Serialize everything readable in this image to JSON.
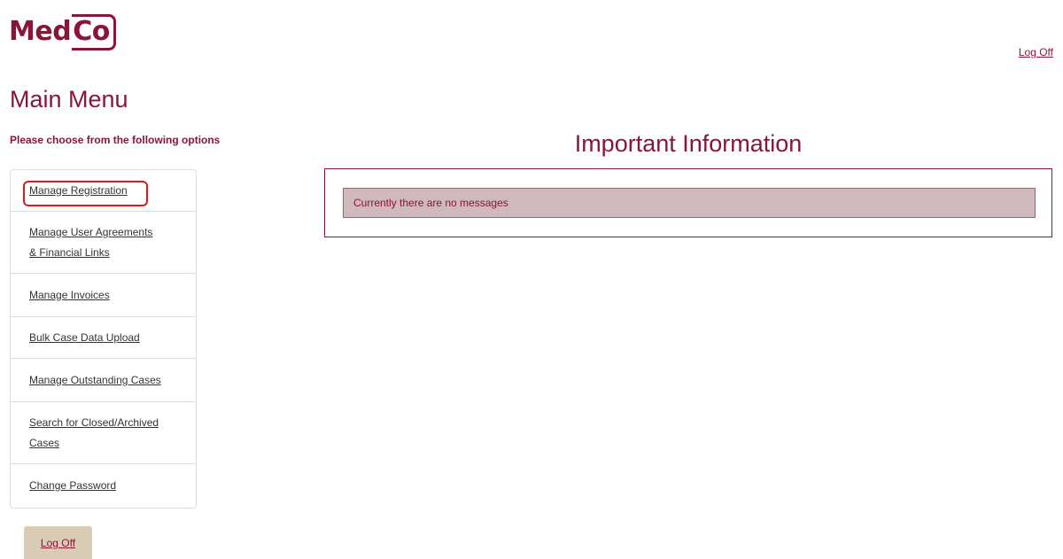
{
  "logo": {
    "part1": "Med",
    "part2": "Co"
  },
  "header": {
    "logoff_label": "Log Off"
  },
  "main": {
    "title": "Main Menu",
    "subtitle": "Please choose from the following options"
  },
  "menu": {
    "items": [
      {
        "line1": "Manage Registration",
        "line2": ""
      },
      {
        "line1": "Manage User Agreements",
        "line2": "& Financial Links"
      },
      {
        "line1": "Manage Invoices",
        "line2": ""
      },
      {
        "line1": "Bulk Case Data Upload",
        "line2": ""
      },
      {
        "line1": "Manage Outstanding Cases",
        "line2": ""
      },
      {
        "line1": "Search for Closed/Archived",
        "line2": "Cases"
      },
      {
        "line1": "Change Password",
        "line2": ""
      }
    ]
  },
  "footer": {
    "logoff_label": "Log Off"
  },
  "info": {
    "heading": "Important Information",
    "message": "Currently there are no messages"
  },
  "colors": {
    "brand": "#8a1538",
    "highlight": "#e0171b",
    "message_bg": "#cfb9bc",
    "button_bg": "#d9cbb4"
  }
}
